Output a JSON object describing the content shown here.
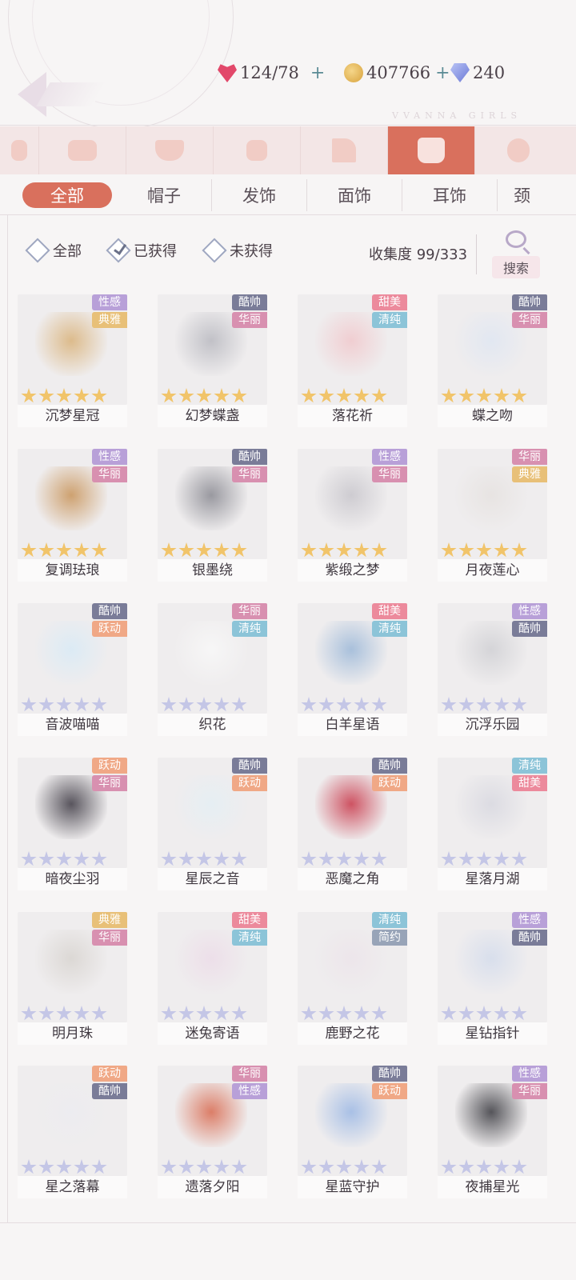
{
  "header": {
    "stamina": "124/78",
    "gold": "407766",
    "diamonds": "240",
    "brand": "VVANNA GIRLS"
  },
  "category_icons": [
    "ribbon-icon",
    "top-icon",
    "skirt-icon",
    "socks-icon",
    "shoes-icon",
    "accessory-bag-icon",
    "glove-icon"
  ],
  "subtabs": [
    "全部",
    "帽子",
    "发饰",
    "面饰",
    "耳饰",
    "颈"
  ],
  "filters": {
    "all": "全部",
    "owned": "已获得",
    "not_owned": "未获得"
  },
  "collect_label": "收集度",
  "collect_value": "99/333",
  "search_label": "搜索",
  "tag_colors": {
    "性感": "#b8a0d8",
    "典雅": "#e8c078",
    "酷帅": "#7a7c98",
    "华丽": "#d890b0",
    "甜美": "#ec8a9c",
    "清纯": "#8cc4d8",
    "跃动": "#f0a886",
    "简约": "#98a4b8"
  },
  "items": [
    {
      "name": "沉梦星冠",
      "tags": [
        "性感",
        "典雅"
      ],
      "stars": "gold",
      "art": "#d9b27a"
    },
    {
      "name": "幻梦蝶盏",
      "tags": [
        "酷帅",
        "华丽"
      ],
      "stars": "gold",
      "art": "#b9b9c0"
    },
    {
      "name": "落花祈",
      "tags": [
        "甜美",
        "清纯"
      ],
      "stars": "gold",
      "art": "#f0c8cc"
    },
    {
      "name": "蝶之吻",
      "tags": [
        "酷帅",
        "华丽"
      ],
      "stars": "gold",
      "art": "#dfe6f2"
    },
    {
      "name": "复调珐琅",
      "tags": [
        "性感",
        "华丽"
      ],
      "stars": "gold",
      "art": "#c8945a"
    },
    {
      "name": "银墨绕",
      "tags": [
        "酷帅",
        "华丽"
      ],
      "stars": "gold",
      "art": "#8a8a92"
    },
    {
      "name": "紫缎之梦",
      "tags": [
        "性感",
        "华丽"
      ],
      "stars": "gold",
      "art": "#c8c6cc"
    },
    {
      "name": "月夜莲心",
      "tags": [
        "华丽",
        "典雅"
      ],
      "stars": "gold",
      "art": "#e6e2e0"
    },
    {
      "name": "音波喵喵",
      "tags": [
        "酷帅",
        "跃动"
      ],
      "stars": "silver",
      "art": "#d8eaf6"
    },
    {
      "name": "织花",
      "tags": [
        "华丽",
        "清纯"
      ],
      "stars": "silver",
      "art": "#f8f8f8"
    },
    {
      "name": "白羊星语",
      "tags": [
        "甜美",
        "清纯"
      ],
      "stars": "silver",
      "art": "#9cb8d8"
    },
    {
      "name": "沉浮乐园",
      "tags": [
        "性感",
        "酷帅"
      ],
      "stars": "silver",
      "art": "#d0d0d4"
    },
    {
      "name": "暗夜尘羽",
      "tags": [
        "跃动",
        "华丽"
      ],
      "stars": "silver",
      "art": "#3e3a44"
    },
    {
      "name": "星辰之音",
      "tags": [
        "酷帅",
        "跃动"
      ],
      "stars": "silver",
      "art": "#e4eef4"
    },
    {
      "name": "恶魔之角",
      "tags": [
        "酷帅",
        "跃动"
      ],
      "stars": "silver",
      "art": "#c8384a"
    },
    {
      "name": "星落月湖",
      "tags": [
        "清纯",
        "甜美"
      ],
      "stars": "silver",
      "art": "#d8d8e0"
    },
    {
      "name": "明月珠",
      "tags": [
        "典雅",
        "华丽"
      ],
      "stars": "silver",
      "art": "#d8d4d0"
    },
    {
      "name": "迷兔寄语",
      "tags": [
        "甜美",
        "清纯"
      ],
      "stars": "silver",
      "art": "#ecdce8"
    },
    {
      "name": "鹿野之花",
      "tags": [
        "清纯",
        "简约"
      ],
      "stars": "silver",
      "art": "#ece4ea"
    },
    {
      "name": "星钻指针",
      "tags": [
        "性感",
        "酷帅"
      ],
      "stars": "silver",
      "art": "#d4dcec"
    },
    {
      "name": "星之落幕",
      "tags": [
        "跃动",
        "酷帅"
      ],
      "stars": "silver",
      "art": "#ececf0"
    },
    {
      "name": "遗落夕阳",
      "tags": [
        "华丽",
        "性感"
      ],
      "stars": "silver",
      "art": "#d86a50"
    },
    {
      "name": "星蓝守护",
      "tags": [
        "酷帅",
        "跃动"
      ],
      "stars": "silver",
      "art": "#9cb8e4"
    },
    {
      "name": "夜捕星光",
      "tags": [
        "性感",
        "华丽"
      ],
      "stars": "silver",
      "art": "#3a3a40"
    }
  ]
}
